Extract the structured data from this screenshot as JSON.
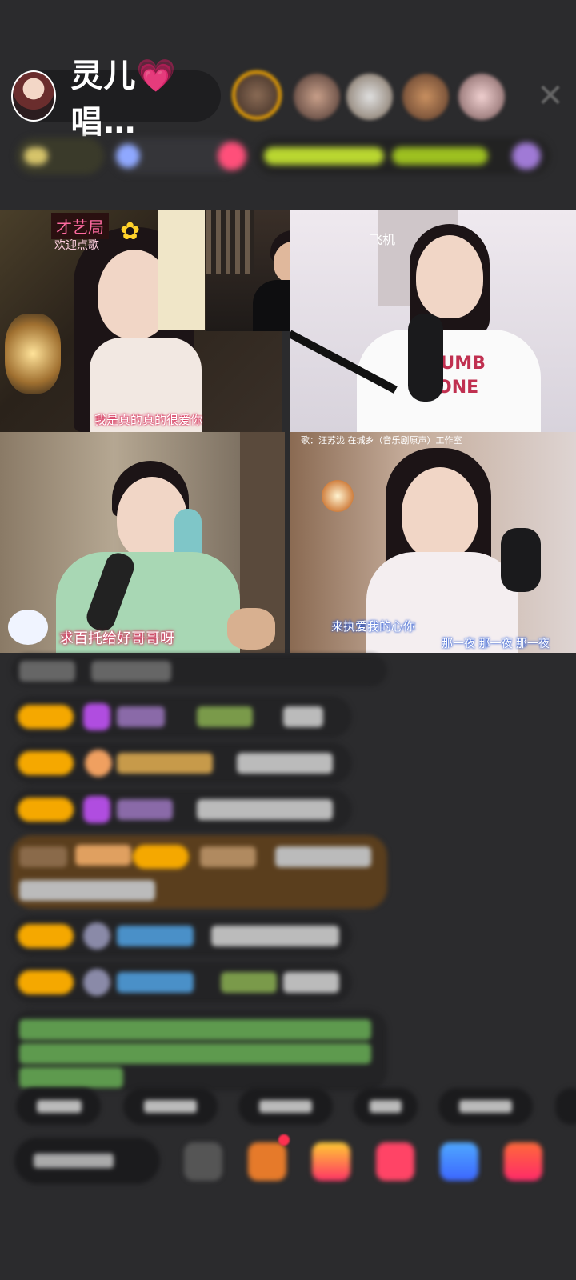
{
  "header": {
    "host_name": "灵儿",
    "host_heart": "💗",
    "host_suffix": "唱…",
    "close_icon": "✕"
  },
  "video_tiles": {
    "top_left": {
      "brand": "才艺局",
      "sub": "欢迎点歌",
      "caption": "我是真的真的很爱你"
    },
    "top_right": {
      "tag": "飞机"
    },
    "bottom_left": {
      "caption": "求百托给好哥哥呀"
    },
    "bottom_right": {
      "top_text": "歌：汪苏泷 在城乡（音乐剧原声）工作室",
      "caption": "来执爱我的心你",
      "caption2": "那一夜 那一夜 那一夜"
    }
  },
  "colors": {
    "background": "#2b2b2d",
    "badge": "#f5a800",
    "chat_bubble": "#232325",
    "gift_highlight": "#5a3e1d"
  },
  "icons": [
    "search-icon",
    "gift-icon",
    "share-icon"
  ]
}
